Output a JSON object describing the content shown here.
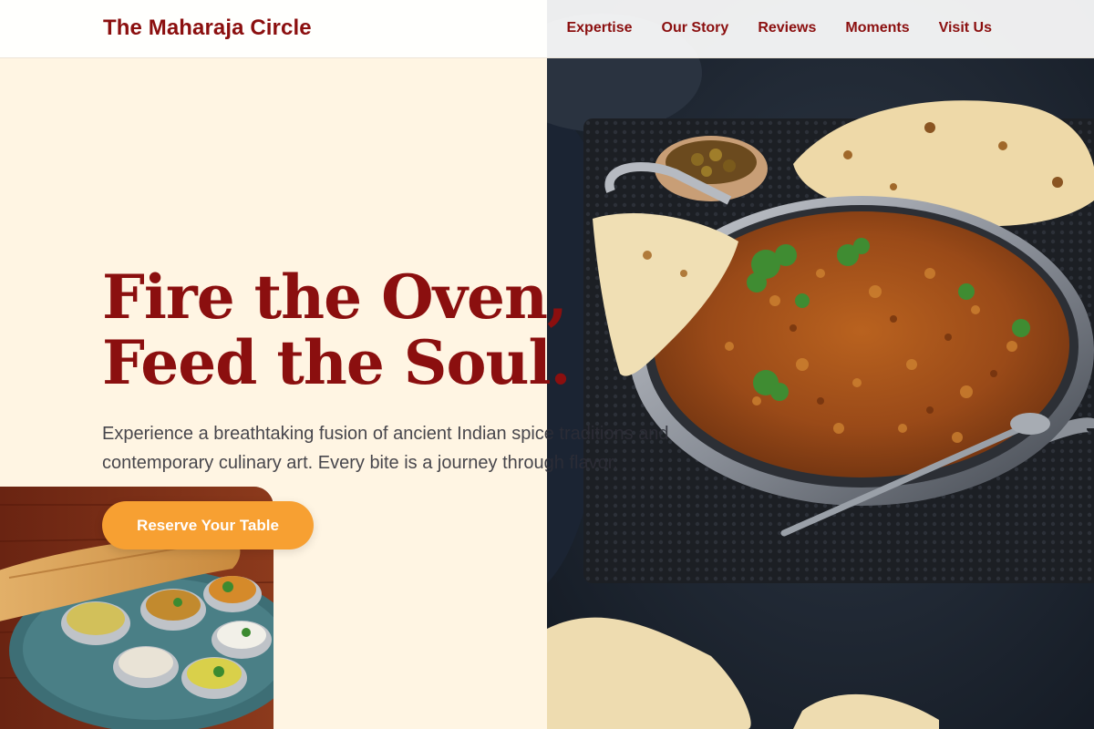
{
  "header": {
    "brand": "The Maharaja Circle",
    "nav": [
      "Expertise",
      "Our Story",
      "Reviews",
      "Moments",
      "Visit Us"
    ]
  },
  "hero": {
    "headline": "Fire the Oven, Feed the Soul.",
    "subtext": "Experience a breathtaking fusion of ancient Indian spice traditions and contemporary culinary art. Every bite is a journey through flavor.",
    "cta": "Reserve Your Table"
  },
  "colors": {
    "brand": "#8b0f0f",
    "accent": "#f7a032",
    "background": "#fff5e3"
  }
}
